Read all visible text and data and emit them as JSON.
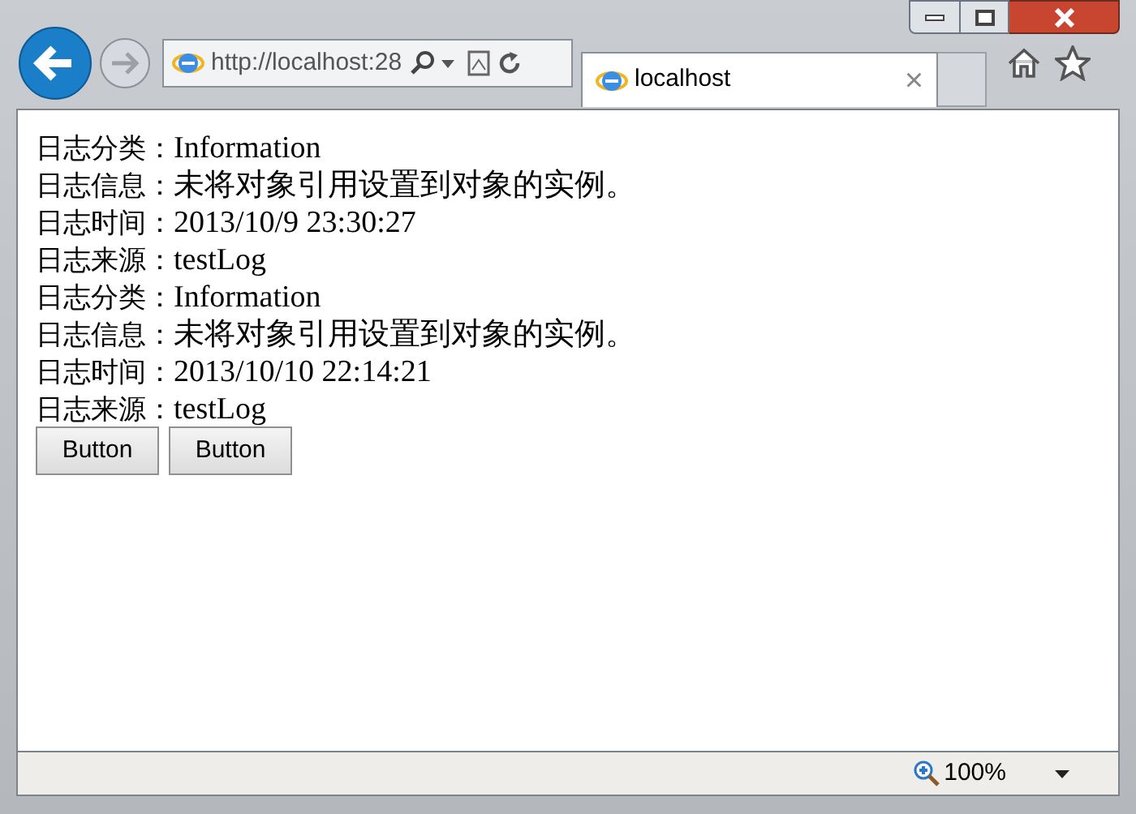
{
  "address_bar": {
    "url": "http://localhost:28"
  },
  "tab": {
    "title": "localhost",
    "close": "×"
  },
  "log_lines": [
    {
      "label": "日志分类：",
      "value": "Information"
    },
    {
      "label": "日志信息：",
      "value": "未将对象引用设置到对象的实例。"
    },
    {
      "label": "日志时间：",
      "value": "2013/10/9 23:30:27"
    },
    {
      "label": "日志来源：",
      "value": "testLog"
    },
    {
      "label": "日志分类：",
      "value": "Information"
    },
    {
      "label": "日志信息：",
      "value": "未将对象引用设置到对象的实例。"
    },
    {
      "label": "日志时间：",
      "value": "2013/10/10 22:14:21"
    },
    {
      "label": "日志来源：",
      "value": "testLog"
    }
  ],
  "buttons": [
    "Button",
    "Button"
  ],
  "status_bar": {
    "zoom": "100%"
  }
}
